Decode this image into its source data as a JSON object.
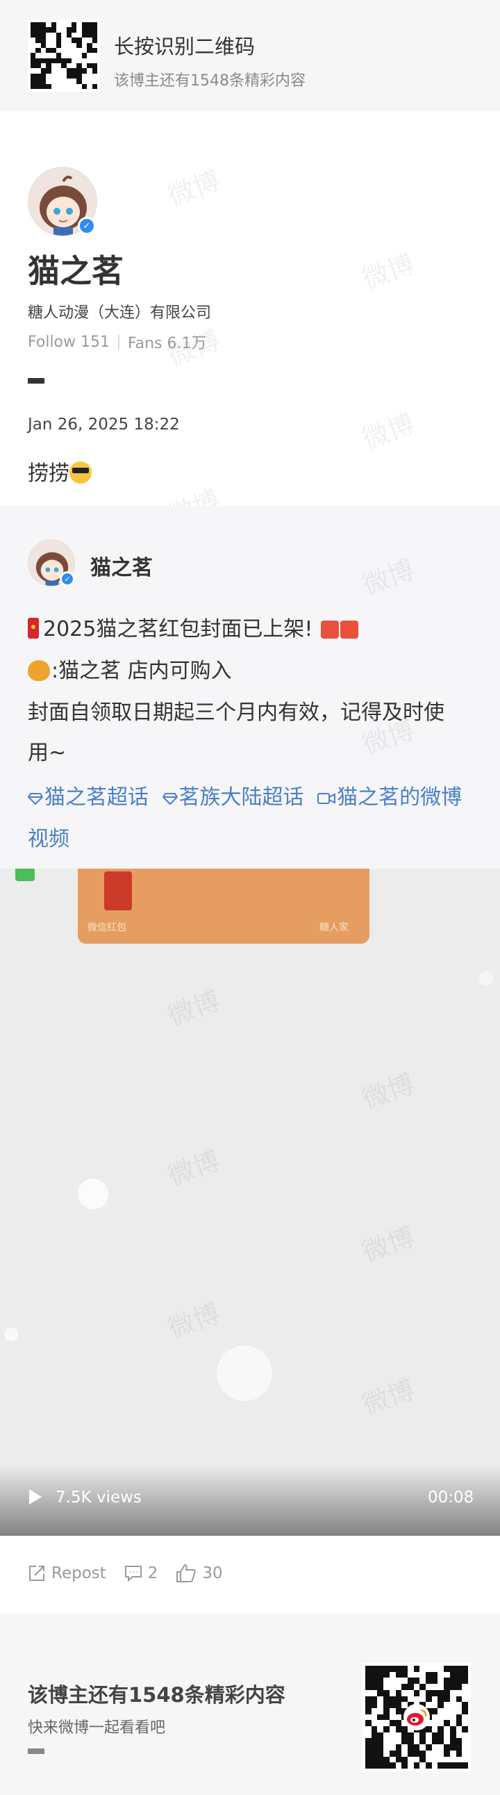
{
  "banner": {
    "title": "长按识别二维码",
    "subtitle": "该博主还有1548条精彩内容"
  },
  "profile": {
    "name": "猫之茗",
    "company": "糖人动漫（大连）有限公司",
    "follow_label": "Follow 151",
    "fans_label": "Fans 6.1万",
    "verified_icon": "verified-badge-icon"
  },
  "post": {
    "date": "Jan 26, 2025 18:22",
    "text": "捞捞"
  },
  "repost": {
    "author": "猫之茗",
    "line1": "2025猫之茗红包封面已上架!",
    "line2": ":猫之茗 店内可购入",
    "line3": "封面自领取日期起三个月内有效，记得及时使",
    "line4": "用~",
    "topics": [
      "猫之茗超话",
      "茗族大陆超话",
      "猫之茗的微博视频"
    ]
  },
  "video": {
    "views": "7.5K views",
    "duration": "00:08",
    "thumb_text_left": "微信红包",
    "thumb_text_right": "糖人家"
  },
  "actions": {
    "repost_label": "Repost",
    "comments_count": "2",
    "likes_count": "30"
  },
  "bottom": {
    "title": "该博主还有1548条精彩内容",
    "subtitle": "快来微博一起看看吧"
  },
  "watermark": "微博",
  "colors": {
    "link": "#4b7fc8",
    "verified": "#2f8cf0",
    "card_bg": "#f6f6f8"
  }
}
